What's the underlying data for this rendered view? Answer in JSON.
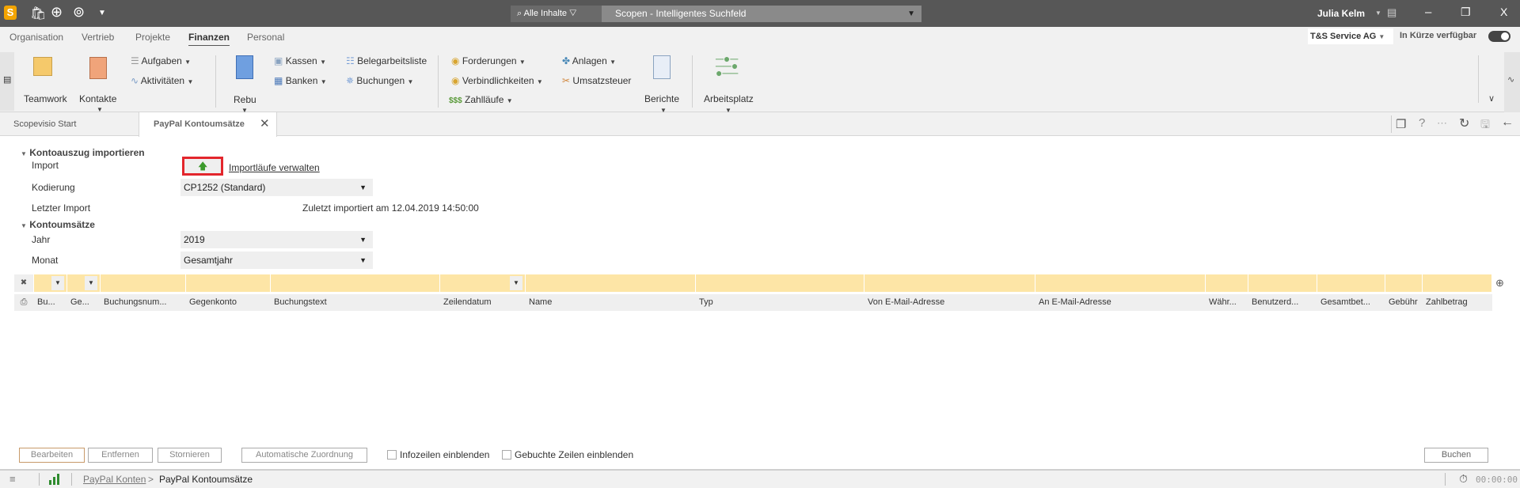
{
  "topbar": {
    "logo": "S",
    "search_scope": "Alle Inhalte",
    "search_placeholder": "Scopen - Intelligentes Suchfeld",
    "user": "Julia Kelm",
    "accent": "#f2a400"
  },
  "menu": {
    "tabs": [
      "Organisation",
      "Vertrieb",
      "Projekte",
      "Finanzen",
      "Personal"
    ],
    "active": "Finanzen",
    "company": "T&S Service AG",
    "soon_label": "In Kürze verfügbar"
  },
  "ribbon": {
    "teamwork": "Teamwork",
    "kontakte": "Kontakte",
    "aufgaben": "Aufgaben",
    "aktivitaeten": "Aktivitäten",
    "rebu": "Rebu",
    "kassen": "Kassen",
    "banken": "Banken",
    "belegarbeitsliste": "Belegarbeitsliste",
    "buchungen": "Buchungen",
    "forderungen": "Forderungen",
    "verbindlichkeiten": "Verbindlichkeiten",
    "zahllaeufe": "Zahlläufe",
    "anlagen": "Anlagen",
    "umsatzsteuer": "Umsatzsteuer",
    "berichte": "Berichte",
    "arbeitsplatz": "Arbeitsplatz"
  },
  "doctabs": {
    "start": "Scopevisio Start",
    "active": "PayPal Kontoumsätze"
  },
  "form": {
    "section_import": "Kontoauszug importieren",
    "import_label": "Import",
    "import_link": "Importläufe verwalten",
    "kodierung_label": "Kodierung",
    "kodierung_value": "CP1252 (Standard)",
    "letzter_label": "Letzter Import",
    "letzter_value": "Zuletzt importiert am 12.04.2019 14:50:00",
    "section_umsaetze": "Kontoumsätze",
    "jahr_label": "Jahr",
    "jahr_value": "2019",
    "monat_label": "Monat",
    "monat_value": "Gesamtjahr"
  },
  "table": {
    "columns": [
      "Bu...",
      "Ge...",
      "Buchungsnum...",
      "Gegenkonto",
      "Buchungstext",
      "Zeilendatum",
      "Name",
      "Typ",
      "Von E-Mail-Adresse",
      "An E-Mail-Adresse",
      "Währ...",
      "Benutzerd...",
      "Gesamtbet...",
      "Gebühr",
      "Zahlbetrag"
    ],
    "filter_color": "#fde5a6"
  },
  "actions": {
    "bearbeiten": "Bearbeiten",
    "entfernen": "Entfernen",
    "stornieren": "Stornieren",
    "auto": "Automatische Zuordnung",
    "infozeilen": "Infozeilen einblenden",
    "gebuchte": "Gebuchte Zeilen einblenden",
    "buchen": "Buchen"
  },
  "status": {
    "breadcrumb_parent": "PayPal Konten",
    "breadcrumb_sep": ">",
    "breadcrumb_current": "PayPal Kontoumsätze",
    "timer": "00:00:00"
  }
}
